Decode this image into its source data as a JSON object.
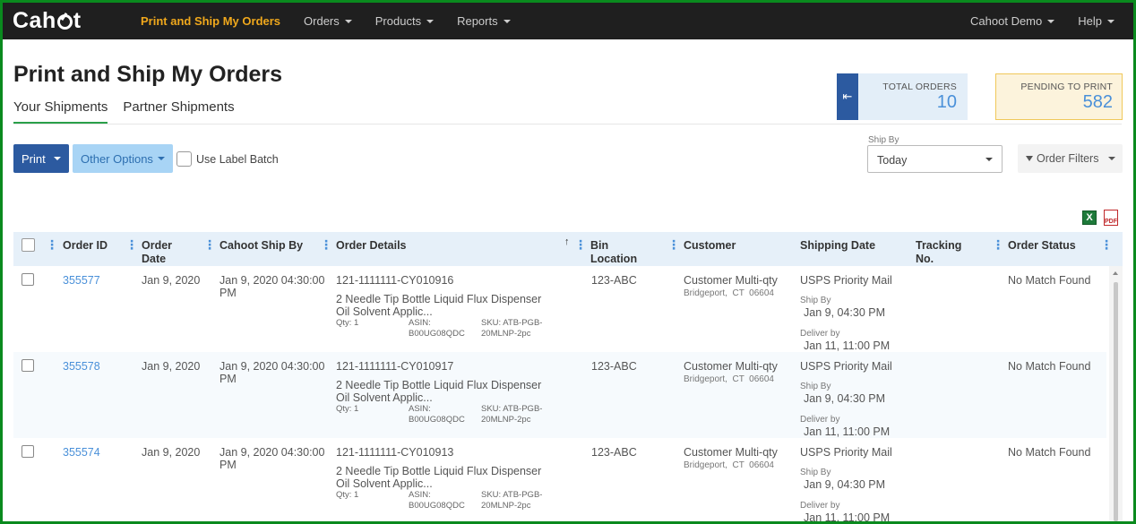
{
  "nav": {
    "logo": "Cahot",
    "items": [
      {
        "label": "Print and Ship My Orders",
        "active": true
      },
      {
        "label": "Orders"
      },
      {
        "label": "Products"
      },
      {
        "label": "Reports"
      }
    ],
    "right": [
      "Cahoot Demo",
      "Help"
    ]
  },
  "header": {
    "title": "Print and Ship My Orders",
    "tabs": [
      "Your Shipments",
      "Partner Shipments"
    ]
  },
  "stats": {
    "total_label": "TOTAL ORDERS",
    "total_value": "10",
    "pending_label": "PENDING TO PRINT",
    "pending_value": "582"
  },
  "toolbar": {
    "print_label": "Print",
    "other_label": "Other Options",
    "batch_label": "Use Label Batch",
    "shipby_label": "Ship By",
    "shipby_value": "Today",
    "filters_label": "Order Filters"
  },
  "table": {
    "columns": [
      "Order ID",
      "Order Date",
      "Cahoot Ship By",
      "Order Details",
      "Bin Location",
      "Customer",
      "Shipping Date",
      "Tracking No.",
      "Order Status"
    ],
    "rows": [
      {
        "order_id": "355577",
        "order_date": "Jan 9, 2020",
        "ship_by": "Jan 9, 2020 04:30:00 PM",
        "order_no": "121-1111111-CY010916",
        "product": "2 Needle Tip Bottle Liquid Flux Dispenser Oil Solvent Applic...",
        "qty": "Qty: 1",
        "asin": "ASIN: B00UG08QDC",
        "sku": "SKU: ATB-PGB-20MLNP-2pc",
        "bin": "123-ABC",
        "customer": "Customer Multi-qty",
        "location": "Bridgeport,  CT  06604",
        "carrier": "USPS Priority Mail",
        "shipby_label": "Ship By",
        "shipby_date": "Jan 9, 04:30 PM",
        "deliver_label": "Deliver by",
        "deliver_date": "Jan 11, 11:00 PM",
        "status": "No Match Found"
      },
      {
        "order_id": "355578",
        "order_date": "Jan 9, 2020",
        "ship_by": "Jan 9, 2020 04:30:00 PM",
        "order_no": "121-1111111-CY010917",
        "product": "2 Needle Tip Bottle Liquid Flux Dispenser Oil Solvent Applic...",
        "qty": "Qty: 1",
        "asin": "ASIN: B00UG08QDC",
        "sku": "SKU: ATB-PGB-20MLNP-2pc",
        "bin": "123-ABC",
        "customer": "Customer Multi-qty",
        "location": "Bridgeport,  CT  06604",
        "carrier": "USPS Priority Mail",
        "shipby_label": "Ship By",
        "shipby_date": "Jan 9, 04:30 PM",
        "deliver_label": "Deliver by",
        "deliver_date": "Jan 11, 11:00 PM",
        "status": "No Match Found"
      },
      {
        "order_id": "355574",
        "order_date": "Jan 9, 2020",
        "ship_by": "Jan 9, 2020 04:30:00 PM",
        "order_no": "121-1111111-CY010913",
        "product": "2 Needle Tip Bottle Liquid Flux Dispenser Oil Solvent Applic...",
        "qty": "Qty: 1",
        "asin": "ASIN: B00UG08QDC",
        "sku": "SKU: ATB-PGB-20MLNP-2pc",
        "bin": "123-ABC",
        "customer": "Customer Multi-qty",
        "location": "Bridgeport,  CT  06604",
        "carrier": "USPS Priority Mail",
        "shipby_label": "Ship By",
        "shipby_date": "Jan 9, 04:30 PM",
        "deliver_label": "Deliver by",
        "deliver_date": "Jan 11, 11:00 PM",
        "status": "No Match Found"
      }
    ]
  },
  "colors": {
    "accent": "#f0a81c",
    "primary": "#2c5aa0",
    "link": "#4a90d9",
    "frame": "#0a8a1e"
  },
  "icons": {
    "excel": "excel-export-icon",
    "pdf": "pdf-export-icon"
  }
}
